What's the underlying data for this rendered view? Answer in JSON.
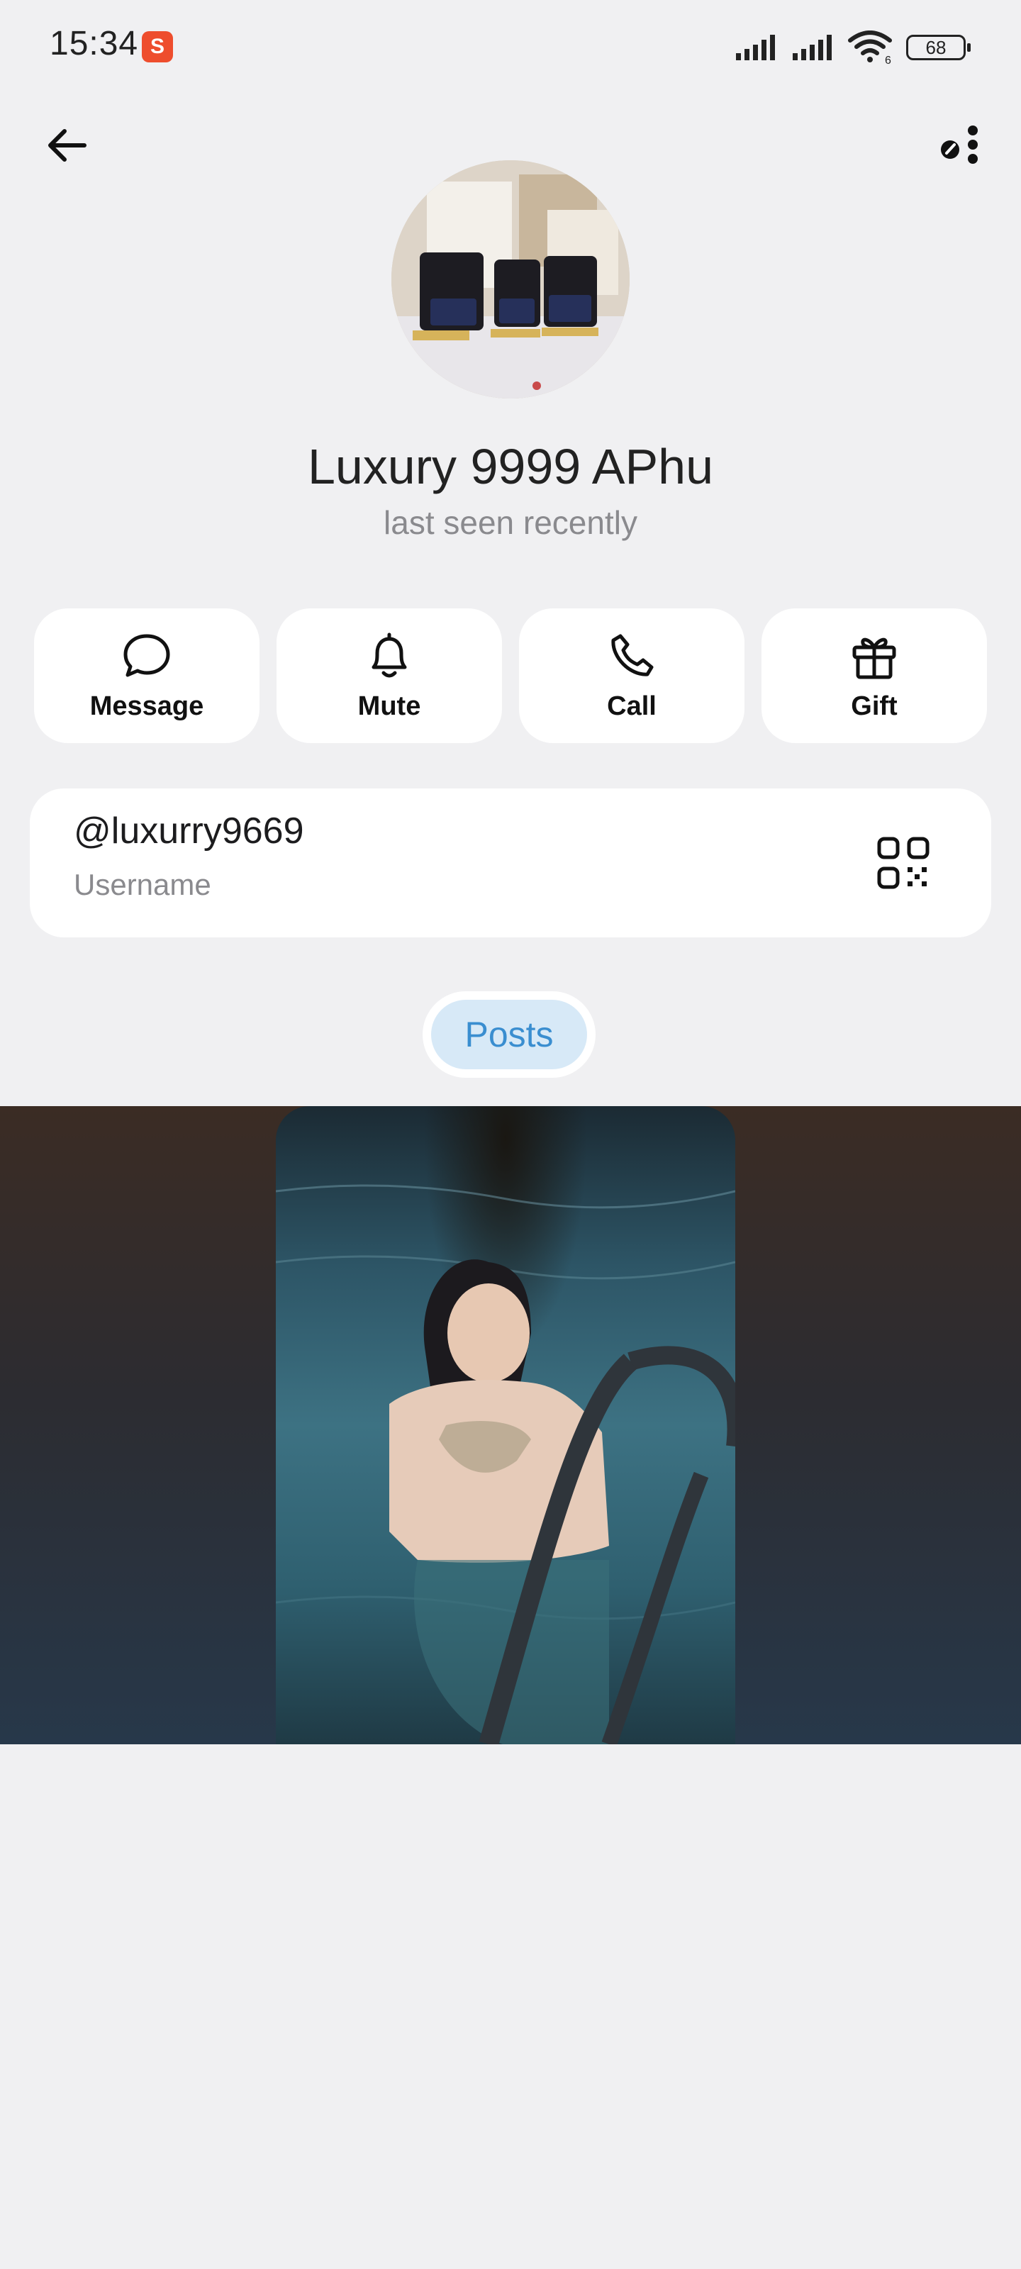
{
  "status_bar": {
    "time": "15:34",
    "app_icon": "shopee-icon",
    "battery": "68",
    "wifi_badge": "6"
  },
  "header": {
    "back_icon": "arrow-left-icon",
    "more_icon": "more-vertical-icon"
  },
  "profile": {
    "name": "Luxury 9999 APhu",
    "status": "last seen recently"
  },
  "actions": [
    {
      "label": "Message",
      "icon": "chat-bubble-icon"
    },
    {
      "label": "Mute",
      "icon": "bell-icon"
    },
    {
      "label": "Call",
      "icon": "phone-icon"
    },
    {
      "label": "Gift",
      "icon": "gift-icon"
    }
  ],
  "username_card": {
    "value": "@luxurry9669",
    "label": "Username",
    "qr_icon": "qr-code-icon"
  },
  "tabs": [
    {
      "label": "Posts",
      "active": true
    }
  ],
  "colors": {
    "background": "#f0f0f2",
    "accent": "#3a8ed0",
    "tab_active_bg": "#d7e9f7"
  }
}
